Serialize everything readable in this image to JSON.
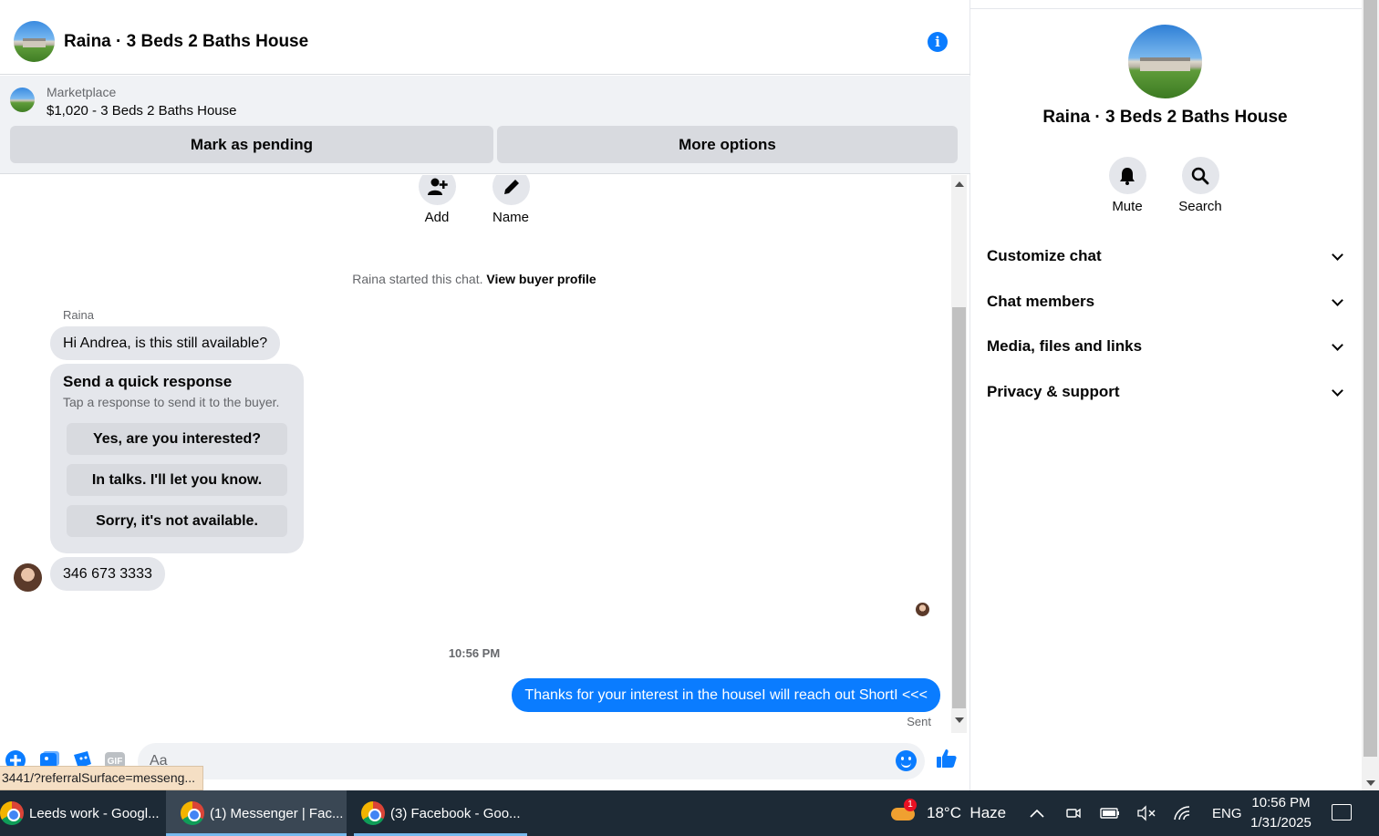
{
  "chat": {
    "title": "Raina · 3 Beds 2 Baths House",
    "marketplace_label": "Marketplace",
    "listing": "$1,020 - 3 Beds 2 Baths House",
    "mark_pending": "Mark as pending",
    "more_options": "More options",
    "actions": {
      "add": "Add",
      "name": "Name"
    },
    "started_text": "Raina started this chat.",
    "view_profile": "View buyer profile",
    "sender": "Raina",
    "message_1": "Hi Andrea, is this still available?",
    "quick_response": {
      "title": "Send a quick response",
      "subtitle": "Tap a response to send it to the buyer.",
      "options": [
        "Yes, are you interested?",
        "In talks. I'll let you know.",
        "Sorry, it's not available."
      ]
    },
    "message_2": "346 673 3333",
    "timestamp": "10:56 PM",
    "outgoing": "Thanks for your interest in the houseI will reach out ShortI <<<",
    "sent_label": "Sent",
    "composer_placeholder": "Aa",
    "status_url": "3441/?referralSurface=messeng..."
  },
  "panel": {
    "title": "Raina · 3 Beds 2 Baths House",
    "mute": "Mute",
    "search": "Search",
    "sections": [
      "Customize chat",
      "Chat members",
      "Media, files and links",
      "Privacy & support"
    ]
  },
  "taskbar": {
    "windows": [
      "Leeds work - Googl...",
      "(1) Messenger | Fac...",
      "(3) Facebook - Goo..."
    ],
    "weather": "18°C  Haze",
    "weather_badge": "1",
    "language": "ENG",
    "time": "10:56 PM",
    "date": "1/31/2025"
  },
  "colors": {
    "accent": "#0a7cff",
    "bubble_in": "#e4e6eb",
    "taskbar": "#1d2a36"
  }
}
